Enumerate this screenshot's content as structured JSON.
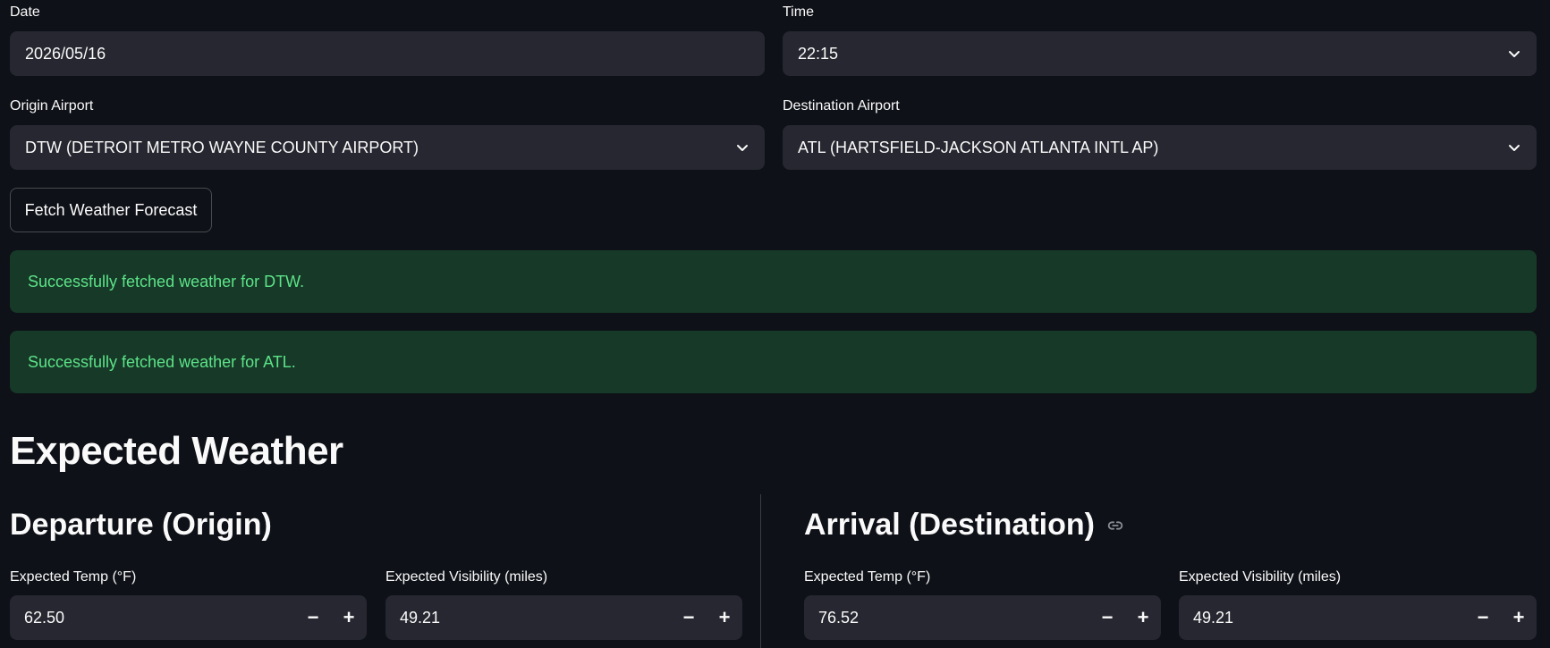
{
  "date": {
    "label": "Date",
    "value": "2026/05/16"
  },
  "time": {
    "label": "Time",
    "value": "22:15"
  },
  "origin": {
    "label": "Origin Airport",
    "value": "DTW (DETROIT METRO WAYNE COUNTY AIRPORT)"
  },
  "destination": {
    "label": "Destination Airport",
    "value": "ATL (HARTSFIELD-JACKSON ATLANTA INTL AP)"
  },
  "fetch_button": {
    "label": "Fetch Weather Forecast"
  },
  "alerts": [
    "Successfully fetched weather for DTW.",
    "Successfully fetched weather for ATL."
  ],
  "section_title": "Expected Weather",
  "departure": {
    "title": "Departure (Origin)",
    "temp_label": "Expected Temp (°F)",
    "temp_value": "62.50",
    "vis_label": "Expected Visibility (miles)",
    "vis_value": "49.21"
  },
  "arrival": {
    "title": "Arrival (Destination)",
    "temp_label": "Expected Temp (°F)",
    "temp_value": "76.52",
    "vis_label": "Expected Visibility (miles)",
    "vis_value": "49.21"
  },
  "stepper": {
    "minus": "−",
    "plus": "+"
  },
  "colors": {
    "background": "#0e1117",
    "input_bg": "#262730",
    "success_bg": "#173928",
    "success_text": "#5ce488"
  }
}
